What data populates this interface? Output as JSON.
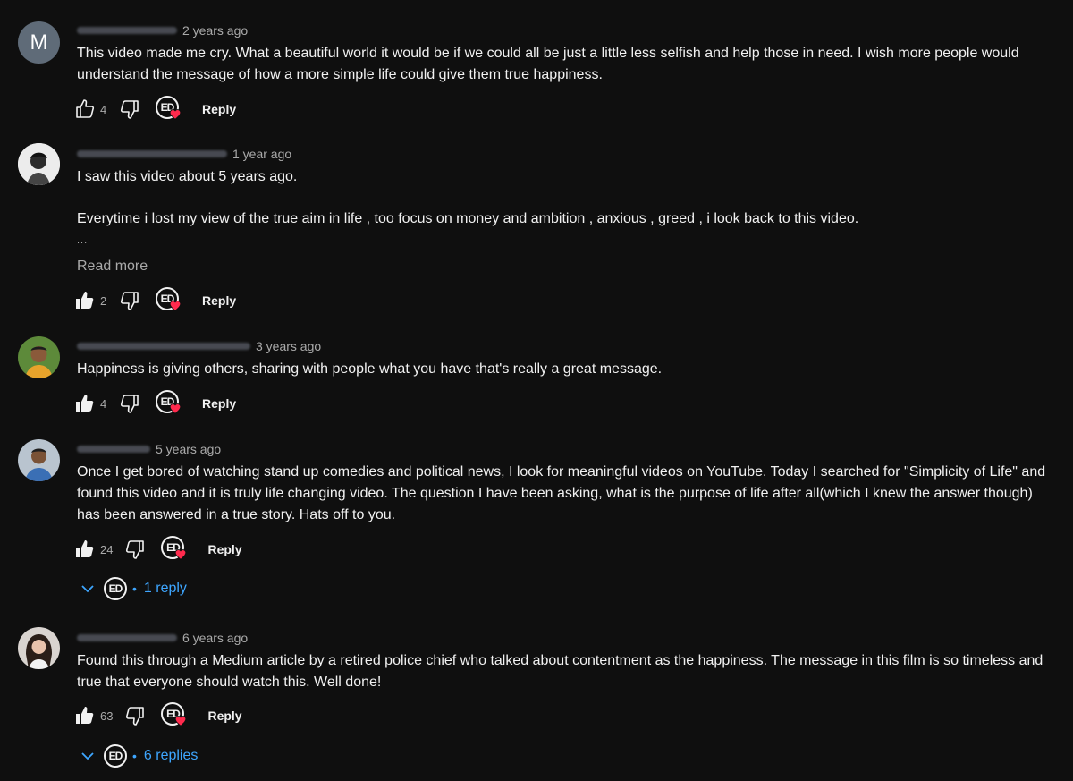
{
  "reply_label": "Reply",
  "read_more_label": "Read more",
  "ellipsis": "...",
  "badge_text": "ED",
  "colors": {
    "background": "#0f0f0f",
    "text": "#f1f1f1",
    "muted": "#aaaaaa",
    "link": "#3ea6ff",
    "heart": "#ff2a4d"
  },
  "comments": [
    {
      "avatar_letter": "M",
      "time": "2 years ago",
      "text": "This video made me cry. What a beautiful world it would be if we could all be just a little less selfish and help those in need. I wish more people would understand the message of how a more simple life could give them true happiness.",
      "likes": "4",
      "liked": false
    },
    {
      "time": "1 year ago",
      "text_lines": [
        "I saw this video about 5 years ago.",
        "Everytime i lost my view of the true aim in life , too focus on money and ambition , anxious , greed , i look back to this video."
      ],
      "likes": "2",
      "liked": true
    },
    {
      "time": "3 years ago",
      "text": "Happiness is giving others, sharing with people what you have that's really a great message.",
      "likes": "4",
      "liked": true
    },
    {
      "time": "5 years ago",
      "text": "Once I get bored of watching stand up comedies and political news, I look for meaningful videos on YouTube. Today I searched for \"Simplicity of Life\" and found this video and it is truly life changing video. The question I have been asking, what is the purpose of life after all(which I knew the answer though) has been answered in a true story. Hats off to you.",
      "likes": "24",
      "liked": true,
      "replies_label": "1 reply"
    },
    {
      "time": "6 years ago",
      "text": "Found this through a Medium article by a retired police chief who talked about contentment as the happiness. The message in this film is so timeless and true that everyone should watch this. Well done!",
      "likes": "63",
      "liked": true,
      "replies_label": "6 replies"
    }
  ]
}
